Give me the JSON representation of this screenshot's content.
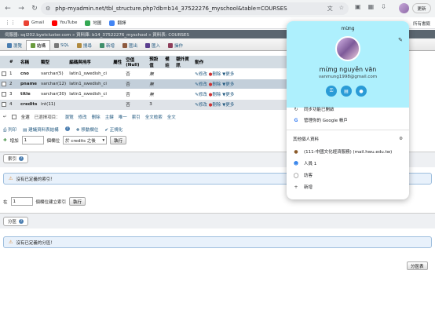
{
  "browser": {
    "url": "php-myadmin.net/tbl_structure.php?db=b14_37522276_myschool&table=COURSES",
    "update_label": "更新"
  },
  "bookmarks": [
    {
      "label": "Gmail",
      "color": "#ea4335"
    },
    {
      "label": "YouTube",
      "color": "#ff0000"
    },
    {
      "label": "地圖",
      "color": "#34a853"
    },
    {
      "label": "翻譯",
      "color": "#4285f4"
    }
  ],
  "bookmarks_right": "所有書籤",
  "breadcrumb": "伺服器: sql202.byetcluster.com » 資料庫: b14_37522276_myschool » 資料表: COURSES",
  "tabs": [
    {
      "label": "瀏覽",
      "color": "#4a7db0"
    },
    {
      "label": "結構",
      "color": "#6a9b3e"
    },
    {
      "label": "SQL",
      "color": "#777"
    },
    {
      "label": "搜尋",
      "color": "#b08a3e"
    },
    {
      "label": "新增",
      "color": "#3e8e6a"
    },
    {
      "label": "匯出",
      "color": "#8e5a3e"
    },
    {
      "label": "匯入",
      "color": "#5a3e8e"
    },
    {
      "label": "操作",
      "color": "#8e3e5a"
    }
  ],
  "table": {
    "headers": [
      "#",
      "名稱",
      "類型",
      "編碼與排序",
      "屬性",
      "空值(Null)",
      "預設值",
      "備註",
      "額外資訊",
      "動作"
    ],
    "rows": [
      {
        "num": "1",
        "name": "cno",
        "type": "varchar(5)",
        "collation": "latin1_swedish_ci",
        "null": "否",
        "default": "無"
      },
      {
        "num": "2",
        "name": "pname",
        "type": "varchar(12)",
        "collation": "latin1_swedish_ci",
        "null": "否",
        "default": "無"
      },
      {
        "num": "3",
        "name": "title",
        "type": "varchar(30)",
        "collation": "latin1_swedish_ci",
        "null": "否",
        "default": "無"
      },
      {
        "num": "4",
        "name": "credits",
        "type": "int(11)",
        "collation": "",
        "null": "否",
        "default": "3"
      }
    ],
    "actions": {
      "edit": "修改",
      "delete": "刪除",
      "more": "更多"
    }
  },
  "with_selected": {
    "check_all": "全選",
    "label": "已選擇項目：",
    "items": [
      "瀏覽",
      "修改",
      "刪除",
      "主鍵",
      "唯一",
      "索引",
      "全文檢索",
      "全文"
    ]
  },
  "tools": {
    "print": "列印",
    "propose": "建議資料表結構",
    "move": "移動欄位",
    "normalize": "正規化"
  },
  "add_columns": {
    "prefix": "增加",
    "count": "1",
    "mid": "個欄位",
    "position": "於 credits 之後",
    "go": "執行"
  },
  "indexes": {
    "legend": "索引",
    "notice": "沒有已定義的索引！",
    "create_prefix": "在",
    "create_count": "1",
    "create_suffix": "個欄位建立索引",
    "go": "執行"
  },
  "partitions": {
    "legend": "分區",
    "notice": "沒有已定義的分區！",
    "partition_button": "分區表"
  },
  "profile": {
    "short_name": "mừng",
    "full_name": "mừng nguyễn văn",
    "email": "vanmung1998@gmail.com",
    "header_color": "#aef0fd",
    "sync": "同步功能已開啟",
    "manage": "管理你的 Google 帳戶",
    "other_profiles": "其他個人資料",
    "profile_work": "(111-中國文化經濟服務) (mail.hwu.edu.tw)",
    "person1": "人員 1",
    "guest": "訪客",
    "add": "新增"
  }
}
